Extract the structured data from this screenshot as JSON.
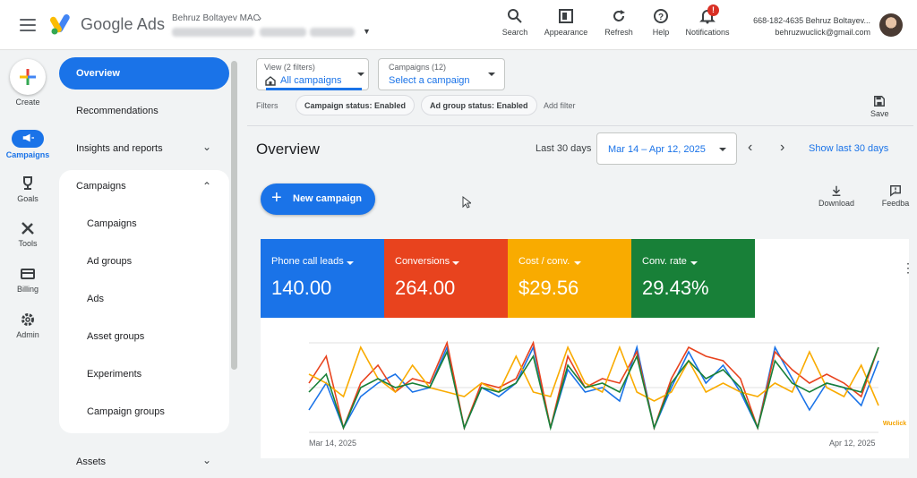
{
  "app": {
    "brand": "Google Ads"
  },
  "account": {
    "name": "Behruz Boltayev MAC",
    "customer_id": "668-182-4635 Behruz Boltayev...",
    "email": "behruzwuclick@gmail.com"
  },
  "toolbar": {
    "search": "Search",
    "appearance": "Appearance",
    "refresh": "Refresh",
    "help": "Help",
    "notifications": "Notifications",
    "notification_count": "!"
  },
  "rail": {
    "create": "Create",
    "campaigns": "Campaigns",
    "goals": "Goals",
    "tools": "Tools",
    "billing": "Billing",
    "admin": "Admin"
  },
  "nav": {
    "overview": "Overview",
    "recommendations": "Recommendations",
    "insights": "Insights and reports",
    "campaigns_group": "Campaigns",
    "sub_items": [
      "Campaigns",
      "Ad groups",
      "Ads",
      "Asset groups",
      "Experiments",
      "Campaign groups"
    ],
    "assets": "Assets"
  },
  "view": {
    "label": "View (2 filters)",
    "value": "All campaigns"
  },
  "campaign_select": {
    "label": "Campaigns (12)",
    "value": "Select a campaign"
  },
  "filters": {
    "label": "Filters",
    "chips": [
      "Campaign status: Enabled",
      "Ad group status: Enabled"
    ],
    "add": "Add filter"
  },
  "save_label": "Save",
  "overview": {
    "title": "Overview",
    "range_label": "Last 30 days",
    "date_range": "Mar 14 – Apr 12, 2025",
    "show_last": "Show last 30 days",
    "prev": "‹",
    "next": "›"
  },
  "new_campaign": "New campaign",
  "download": "Download",
  "feedback": "Feedba",
  "metrics": [
    {
      "label": "Phone call leads",
      "value": "140.00",
      "color": "#1a73e8"
    },
    {
      "label": "Conversions",
      "value": "264.00",
      "color": "#e8431e"
    },
    {
      "label": "Cost / conv.",
      "value": "$29.56",
      "color": "#f9ab00"
    },
    {
      "label": "Conv. rate",
      "value": "29.43%",
      "color": "#188038"
    }
  ],
  "chart_data": {
    "type": "line",
    "x_start": "Mar 14, 2025",
    "x_end": "Apr 12, 2025",
    "series": [
      {
        "color": "#1a73e8",
        "values": [
          0.25,
          0.55,
          0.05,
          0.4,
          0.55,
          0.65,
          0.45,
          0.5,
          0.95,
          0.05,
          0.5,
          0.4,
          0.55,
          0.95,
          0.05,
          0.7,
          0.45,
          0.5,
          0.35,
          0.95,
          0.05,
          0.5,
          0.9,
          0.55,
          0.75,
          0.45,
          0.05,
          0.95,
          0.6,
          0.25,
          0.55,
          0.5,
          0.3,
          0.8
        ]
      },
      {
        "color": "#e8431e",
        "values": [
          0.55,
          0.85,
          0.05,
          0.55,
          0.75,
          0.45,
          0.6,
          0.55,
          1.0,
          0.05,
          0.55,
          0.5,
          0.6,
          1.0,
          0.05,
          0.85,
          0.5,
          0.6,
          0.55,
          0.9,
          0.05,
          0.6,
          0.95,
          0.85,
          0.8,
          0.6,
          0.05,
          0.9,
          0.7,
          0.55,
          0.65,
          0.55,
          0.4,
          0.95
        ]
      },
      {
        "color": "#f9ab00",
        "values": [
          0.65,
          0.55,
          0.4,
          0.95,
          0.6,
          0.45,
          0.75,
          0.5,
          0.45,
          0.4,
          0.55,
          0.45,
          0.85,
          0.45,
          0.4,
          0.95,
          0.55,
          0.45,
          0.95,
          0.45,
          0.35,
          0.45,
          0.8,
          0.45,
          0.55,
          0.45,
          0.4,
          0.55,
          0.45,
          0.9,
          0.5,
          0.4,
          0.75,
          0.3
        ]
      },
      {
        "color": "#188038",
        "values": [
          0.45,
          0.65,
          0.05,
          0.5,
          0.6,
          0.5,
          0.55,
          0.5,
          0.9,
          0.05,
          0.5,
          0.45,
          0.55,
          0.85,
          0.05,
          0.75,
          0.5,
          0.55,
          0.45,
          0.85,
          0.05,
          0.55,
          0.8,
          0.6,
          0.7,
          0.5,
          0.05,
          0.8,
          0.55,
          0.45,
          0.55,
          0.5,
          0.45,
          0.95
        ]
      }
    ]
  },
  "watermark": "Wuclick"
}
